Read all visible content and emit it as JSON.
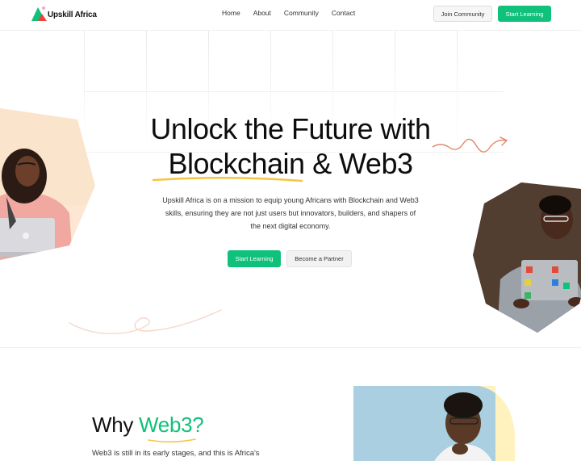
{
  "nav": {
    "logo_text": "Upskill Africa",
    "links": [
      "Home",
      "About",
      "Community",
      "Contact"
    ],
    "join_label": "Join Community",
    "start_label": "Start Learning"
  },
  "hero": {
    "headline_line1": "Unlock the Future with",
    "headline_line2_a": "Blockchain",
    "headline_line2_b": " & Web3",
    "description": "Upskill Africa is on a mission to equip young Africans with Blockchain and Web3 skills, ensuring they are not just users but innovators, builders, and shapers of the next digital economy.",
    "primary_button": "Start Learning",
    "secondary_button": "Become a Partner"
  },
  "why": {
    "title_a": "Why ",
    "title_b": "Web3?",
    "copy": "Web3 is still in its early stages, and this is Africa's"
  },
  "colors": {
    "accent": "#0fc17a",
    "underline": "#f5c542",
    "squiggle": "#e2866a"
  }
}
